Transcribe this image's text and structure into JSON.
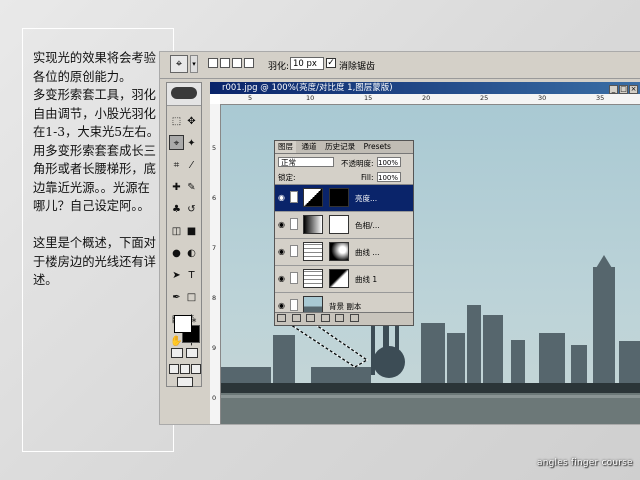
{
  "note": {
    "text": "实现光的效果将会考验各位的原创能力。\n多变形索套工具，羽化自由调节，小股光羽化在1-3，大束光5左右。\n用多变形索套套成长三角形或者长腰梯形，底边靠近光源。。光源在哪儿？自己设定阿。。\n\n这里是个概述，下面对于楼房边的光线还有详述。"
  },
  "options_bar": {
    "feather_label": "羽化:",
    "feather_value": "10 px",
    "antialias_label": "消除锯齿",
    "antialias_checked": "✓"
  },
  "document": {
    "title": "r001.jpg @ 100%(亮度/对比度 1,图层蒙版)",
    "ruler_h": [
      "5",
      "10",
      "15",
      "20",
      "25",
      "30",
      "35"
    ],
    "ruler_v": [
      "5",
      "6",
      "7",
      "8",
      "9",
      "0"
    ]
  },
  "layers_panel": {
    "tabs": [
      "图层",
      "通道",
      "历史记录",
      "Presets"
    ],
    "blend_mode": "正常",
    "opacity_label": "不透明度:",
    "opacity_value": "100%",
    "lock_label": "锁定:",
    "fill_label": "Fill:",
    "fill_value": "100%",
    "layers": [
      {
        "name": "亮度...",
        "selected": true
      },
      {
        "name": "色相/...",
        "selected": false
      },
      {
        "name": "曲线 ...",
        "selected": false
      },
      {
        "name": "曲线 1",
        "selected": false
      },
      {
        "name": "背景 副本",
        "selected": false
      }
    ]
  },
  "credit": "angles finger course",
  "colors": {
    "title_bar": "#0a246a",
    "panel_gray": "#d4d0c8",
    "sky": "#9cc0cc"
  },
  "icons": [
    "lasso-icon",
    "move-icon",
    "crop-icon",
    "brush-icon",
    "eraser-icon",
    "text-icon",
    "hand-icon",
    "zoom-icon",
    "eye-icon",
    "minimize-icon",
    "maximize-icon",
    "close-icon"
  ]
}
